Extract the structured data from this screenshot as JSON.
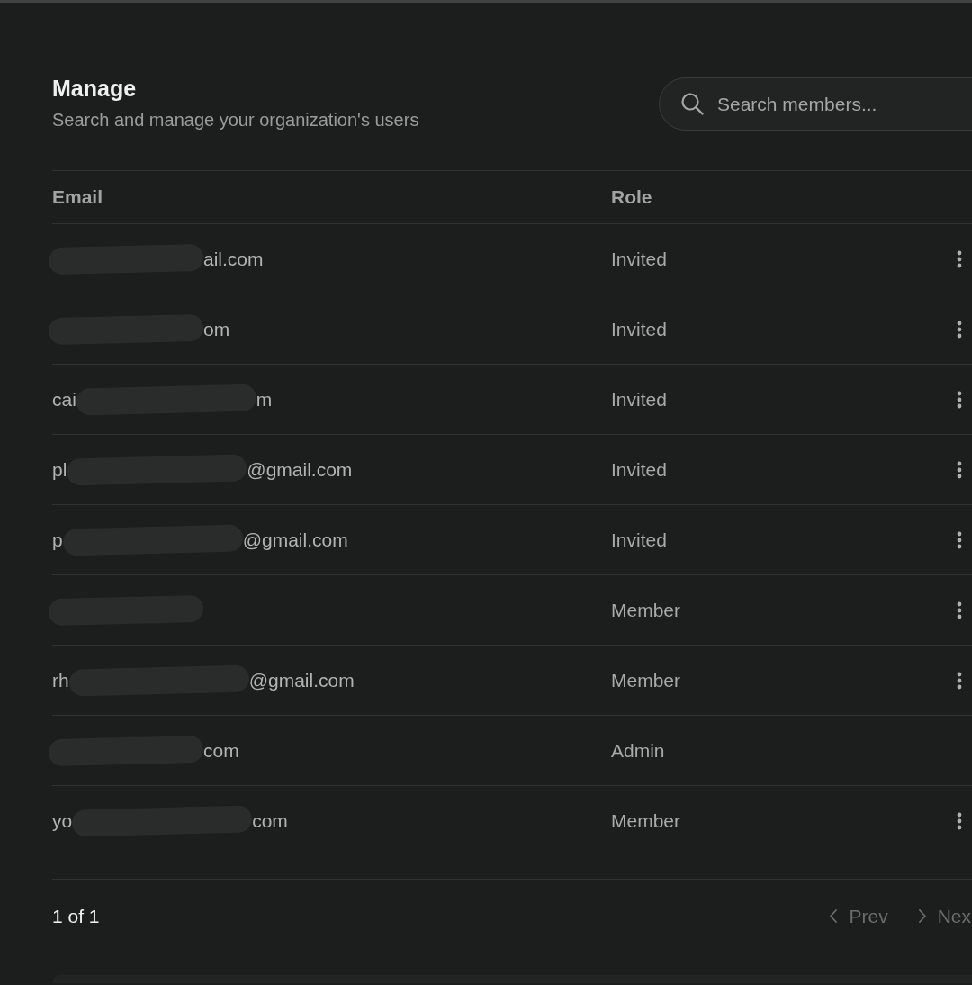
{
  "header": {
    "title": "Manage",
    "subtitle": "Search and manage your organization's users"
  },
  "search": {
    "placeholder": "Search members..."
  },
  "table": {
    "columns": [
      "Email",
      "Role"
    ],
    "rows": [
      {
        "email": [
          {
            "kind": "redacted"
          },
          {
            "kind": "text",
            "text": "ail.com"
          }
        ],
        "role": "Invited",
        "menu": true
      },
      {
        "email": [
          {
            "kind": "redacted"
          },
          {
            "kind": "text",
            "text": "om"
          }
        ],
        "role": "Invited",
        "menu": true
      },
      {
        "email": [
          {
            "kind": "text",
            "text": "cai"
          },
          {
            "kind": "redacted"
          },
          {
            "kind": "text",
            "text": "m"
          }
        ],
        "role": "Invited",
        "menu": true
      },
      {
        "email": [
          {
            "kind": "text",
            "text": "pl"
          },
          {
            "kind": "redacted"
          },
          {
            "kind": "text",
            "text": "@gmail.com"
          }
        ],
        "role": "Invited",
        "menu": true
      },
      {
        "email": [
          {
            "kind": "text",
            "text": "p"
          },
          {
            "kind": "redacted"
          },
          {
            "kind": "text",
            "text": "@gmail.com"
          }
        ],
        "role": "Invited",
        "menu": true
      },
      {
        "email": [
          {
            "kind": "redacted"
          }
        ],
        "role": "Member",
        "menu": true
      },
      {
        "email": [
          {
            "kind": "text",
            "text": "rh"
          },
          {
            "kind": "redacted"
          },
          {
            "kind": "text",
            "text": "@gmail.com"
          }
        ],
        "role": "Member",
        "menu": true
      },
      {
        "email": [
          {
            "kind": "redacted"
          },
          {
            "kind": "text",
            "text": "com"
          }
        ],
        "role": "Admin",
        "menu": false
      },
      {
        "email": [
          {
            "kind": "text",
            "text": "yo"
          },
          {
            "kind": "redacted"
          },
          {
            "kind": "text",
            "text": "com"
          }
        ],
        "role": "Member",
        "menu": true
      }
    ]
  },
  "pagination": {
    "summary": "1 of 1",
    "buttons": [
      {
        "kind": "prev",
        "label": "Prev",
        "disabled": true
      },
      {
        "kind": "next",
        "label": "Nex",
        "disabled": true
      }
    ]
  }
}
